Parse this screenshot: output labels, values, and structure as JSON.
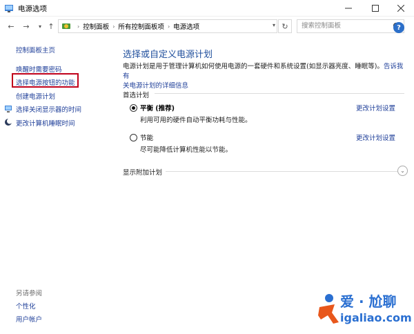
{
  "window": {
    "title": "电源选项"
  },
  "nav": {
    "breadcrumbs": [
      "控制面板",
      "所有控制面板项",
      "电源选项"
    ],
    "search_placeholder": "搜索控制面板"
  },
  "sidebar": {
    "home": "控制面板主页",
    "items": [
      "唤醒时需要密码",
      "选择电源按钮的功能",
      "创建电源计划",
      "选择关闭显示器的时间",
      "更改计算机睡眠时间"
    ],
    "see_also_label": "另请参阅",
    "see_also": [
      "个性化",
      "用户帐户"
    ]
  },
  "main": {
    "title": "选择或自定义电源计划",
    "description": "电源计划是用于管理计算机如何使用电源的一套硬件和系统设置(如显示器亮度、睡眠等)。",
    "desc_link_a": "告诉我有",
    "desc_link_b": "关电源计划的详细信息",
    "preferred_label": "首选计划",
    "plans": [
      {
        "name": "平衡 (推荐)",
        "desc": "利用可用的硬件自动平衡功耗与性能。",
        "link": "更改计划设置",
        "selected": true
      },
      {
        "name": "节能",
        "desc": "尽可能降低计算机性能以节能。",
        "link": "更改计划设置",
        "selected": false
      }
    ],
    "more_plans_label": "显示附加计划"
  },
  "watermark": {
    "brand": "爱 · 尬聊",
    "url": "igaliao.com"
  },
  "colors": {
    "link": "#1f3f99",
    "title": "#1f4e9c",
    "highlight": "#c0001a",
    "accent": "#2c6fc9"
  }
}
